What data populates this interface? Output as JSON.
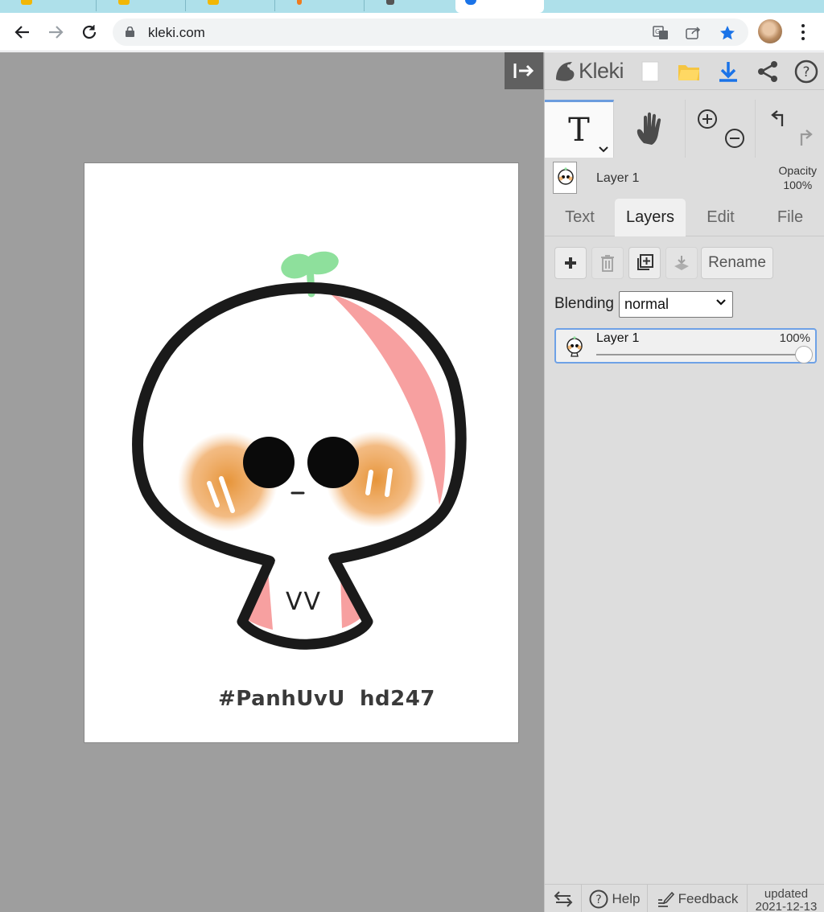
{
  "browser": {
    "url": "kleki.com",
    "nav": {
      "back_icon": "back-arrow-icon",
      "forward_icon": "forward-arrow-icon",
      "reload_icon": "reload-icon"
    }
  },
  "canvas": {
    "caption_left": "#PanhUvU",
    "caption_right": "hd247",
    "mouth_text": "VV",
    "colors": {
      "leaf": "#8ee09c",
      "blush": "#ec9a3e",
      "shine": "#f7a0a0",
      "outline": "#1a1a1a"
    }
  },
  "panel": {
    "logo_text": "Kleki",
    "layer_name": "Layer 1",
    "opacity_label": "Opacity",
    "opacity_value": "100%",
    "tabs": [
      "Text",
      "Layers",
      "Edit",
      "File"
    ],
    "active_tab": "Layers",
    "rename_label": "Rename",
    "blending_label": "Blending",
    "blending_value": "normal",
    "layers": [
      {
        "name": "Layer 1",
        "opacity": "100%",
        "opacity_fraction": 1.0
      }
    ],
    "bottom": {
      "help_label": "Help",
      "feedback_label": "Feedback",
      "updated_line1": "updated",
      "updated_line2": "2021-12-13"
    },
    "accent_color": "#6b9cde"
  }
}
